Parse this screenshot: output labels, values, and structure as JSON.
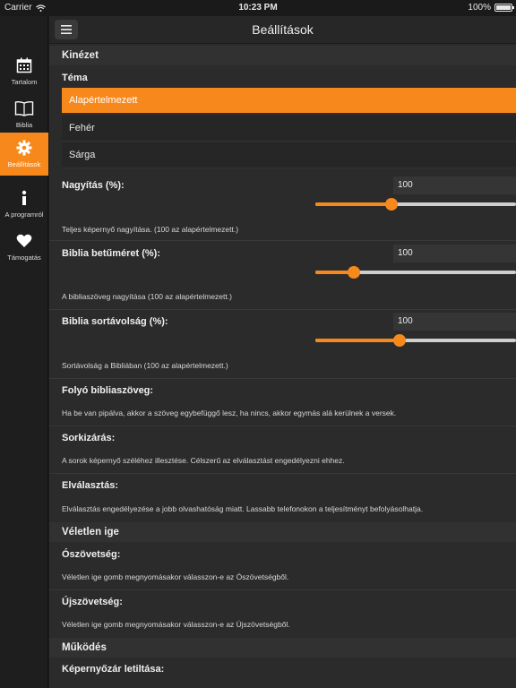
{
  "status": {
    "carrier": "Carrier",
    "time": "10:23 PM",
    "battery": "100%",
    "battery_level": 1.0
  },
  "sidebar": {
    "items": [
      {
        "label": "Tartalom",
        "icon": "calendar-icon"
      },
      {
        "label": "Biblia",
        "icon": "book-icon"
      },
      {
        "label": "Beállítások",
        "icon": "gear-icon",
        "active": true
      },
      {
        "label": "A programról",
        "icon": "info-icon"
      },
      {
        "label": "Támogatás",
        "icon": "heart-icon"
      }
    ]
  },
  "navbar": {
    "title": "Beállítások",
    "menu_icon": "hamburger-icon"
  },
  "kinezet": {
    "header": "Kinézet",
    "tema": {
      "title": "Téma",
      "options": [
        "Alapértelmezett",
        "Fehér",
        "Sárga"
      ],
      "selected": "Alapértelmezett"
    },
    "nagyitas": {
      "title": "Nagyítás (%):",
      "value": "100",
      "slider_fraction": 0.38,
      "desc": "Teljes képernyő nagyítása. (100 az alapértelmezett.)"
    },
    "betumeret": {
      "title": "Biblia betűméret (%):",
      "value": "100",
      "slider_fraction": 0.19,
      "desc": "A bibliaszöveg nagyítása (100 az alapértelmezett.)"
    },
    "sortavolsag": {
      "title": "Biblia sortávolság (%):",
      "value": "100",
      "slider_fraction": 0.42,
      "desc": "Sortávolság a Bibliában (100 az alapértelmezett.)"
    },
    "folyo": {
      "title": "Folyó bibliaszöveg:",
      "desc": "Ha be van pipálva, akkor a szöveg egybefüggő lesz, ha nincs, akkor egymás alá kerülnek a versek."
    },
    "sorkizaras": {
      "title": "Sorkizárás:",
      "desc": "A sorok képernyő széléhez illesztése. Célszerű az elválasztást engedélyezni ehhez."
    },
    "elvalasztas": {
      "title": "Elválasztás:",
      "desc": "Elválasztás engedélyezése a jobb olvashatóság miatt. Lassabb telefonokon a teljesítményt befolyásolhatja."
    }
  },
  "veletlen": {
    "header": "Véletlen ige",
    "oszovetseg": {
      "title": "Ószövetség:",
      "desc": "Véletlen ige gomb megnyomásakor válasszon-e az Ószövetségből."
    },
    "ujszovetseg": {
      "title": "Újszövetség:",
      "desc": "Véletlen ige gomb megnyomásakor válasszon-e az Újszövetségből."
    }
  },
  "mukodes": {
    "header": "Működés",
    "kepernyozar": {
      "title": "Képernyőzár letiltása:"
    }
  }
}
